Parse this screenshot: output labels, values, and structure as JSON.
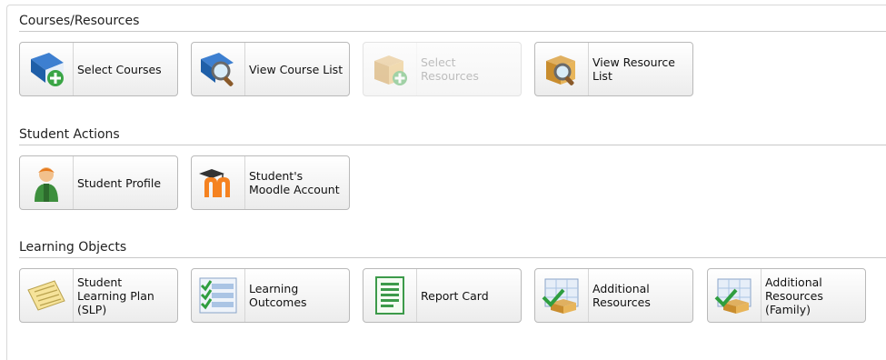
{
  "sections": [
    {
      "title": "Courses/Resources",
      "tiles": [
        {
          "label": "Select Courses",
          "icon": "book-add-icon",
          "disabled": false
        },
        {
          "label": "View Course List",
          "icon": "book-search-icon",
          "disabled": false
        },
        {
          "label": "Select\nResources",
          "icon": "box-add-icon",
          "disabled": true
        },
        {
          "label": "View Resource\nList",
          "icon": "box-search-icon",
          "disabled": false
        }
      ]
    },
    {
      "title": "Student Actions",
      "tiles": [
        {
          "label": "Student Profile",
          "icon": "student-icon",
          "disabled": false
        },
        {
          "label": "Student's\nMoodle Account",
          "icon": "moodle-icon",
          "disabled": false
        }
      ]
    },
    {
      "title": "Learning Objects",
      "tiles": [
        {
          "label": "Student\nLearning Plan\n(SLP)",
          "icon": "note-icon",
          "disabled": false
        },
        {
          "label": "Learning\nOutcomes",
          "icon": "checklist-icon",
          "disabled": false
        },
        {
          "label": "Report Card",
          "icon": "report-card-icon",
          "disabled": false
        },
        {
          "label": "Additional\nResources",
          "icon": "resources-box-icon",
          "disabled": false
        },
        {
          "label": "Additional\nResources\n(Family)",
          "icon": "resources-family-icon",
          "disabled": false
        }
      ]
    }
  ]
}
